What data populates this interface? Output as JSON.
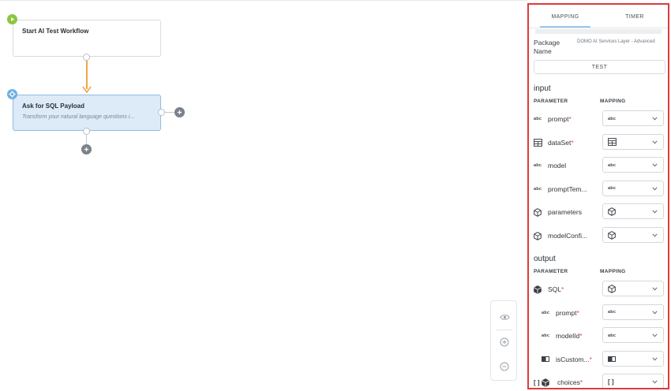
{
  "canvas": {
    "start_node": {
      "title": "Start AI Test Workflow"
    },
    "sql_node": {
      "title": "Ask for SQL Payload",
      "description": "Transform your natural language questions i..."
    }
  },
  "panel": {
    "tabs": [
      {
        "label": "MAPPING",
        "active": true
      },
      {
        "label": "TIMER",
        "active": false
      }
    ],
    "package": {
      "label": "Package Name",
      "value": "DOMO AI Services Layer - Advanced"
    },
    "test_label": "TEST",
    "input": {
      "title": "input",
      "col_param": "PARAMETER",
      "col_mapping": "MAPPING",
      "rows": [
        {
          "name": "prompt",
          "required": "*",
          "icon": "text-type-icon",
          "mapping_icon": "text-type-icon"
        },
        {
          "name": "dataSet",
          "required": "*",
          "icon": "table-icon",
          "mapping_icon": "table-icon"
        },
        {
          "name": "model",
          "required": "",
          "icon": "text-type-icon",
          "mapping_icon": "text-type-icon"
        },
        {
          "name": "promptTem...",
          "required": "",
          "icon": "text-type-icon",
          "mapping_icon": "text-type-icon"
        },
        {
          "name": "parameters",
          "required": "",
          "icon": "cube-icon",
          "mapping_icon": "cube-icon"
        },
        {
          "name": "modelConfi...",
          "required": "",
          "icon": "cube-icon",
          "mapping_icon": "cube-icon"
        }
      ]
    },
    "output": {
      "title": "output",
      "col_param": "PARAMETER",
      "col_mapping": "MAPPING",
      "rows": [
        {
          "name": "SQL",
          "required": "*",
          "icon": "cube-filled-icon",
          "mapping_icon": "cube-icon"
        },
        {
          "name": "prompt",
          "required": "*",
          "icon": "text-type-icon",
          "mapping_icon": "text-type-icon"
        },
        {
          "name": "modelId",
          "required": "*",
          "icon": "text-type-icon",
          "mapping_icon": "text-type-icon"
        },
        {
          "name": "isCustom...",
          "required": "*",
          "icon": "toggle-icon",
          "mapping_icon": "toggle-icon"
        },
        {
          "name": "choices",
          "required": "*",
          "icon": "array-cube-icon",
          "mapping_icon": "array-icon"
        }
      ]
    }
  },
  "glyphs": {
    "abc": "abc",
    "array": "[ ]"
  },
  "colors": {
    "accent": "#9cc7ea",
    "selected_node": "#dcebf7",
    "connector": "#f2a541",
    "panel_border": "#e03a3a",
    "required": "#e04a4a"
  }
}
